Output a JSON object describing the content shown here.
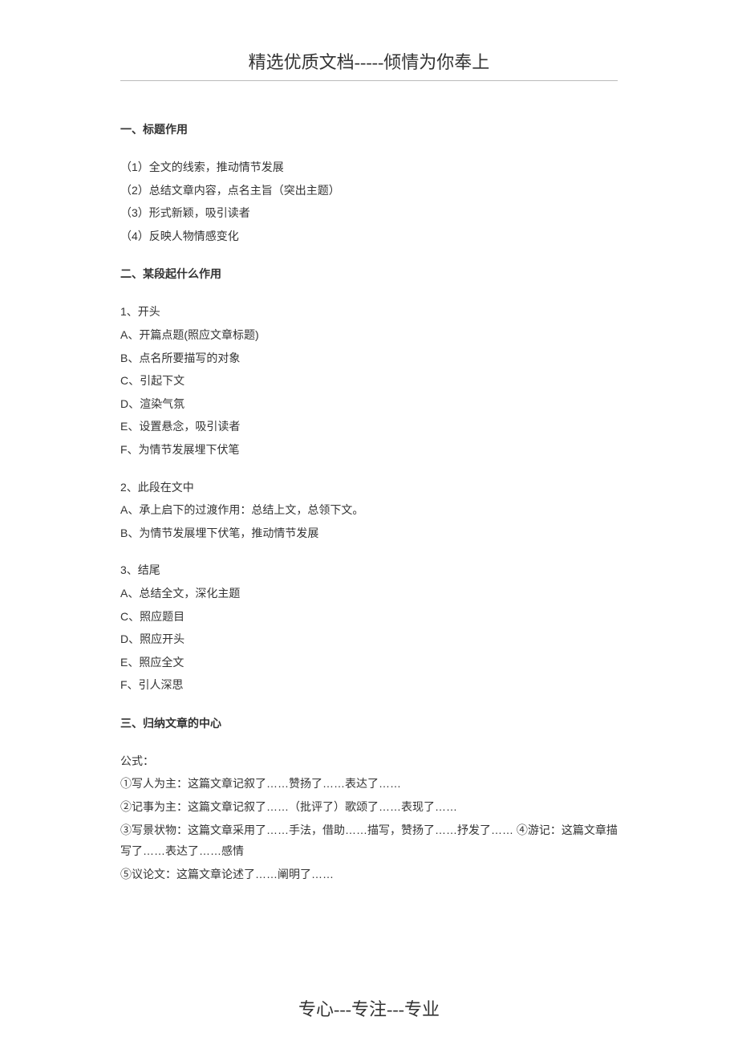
{
  "header": "精选优质文档-----倾情为你奉上",
  "footer": "专心---专注---专业",
  "sections": {
    "s1": {
      "heading": "一、标题作用",
      "items": [
        "（1）全文的线索，推动情节发展",
        "（2）总结文章内容，点名主旨（突出主题）",
        "（3）形式新颖，吸引读者",
        "（4）反映人物情感变化"
      ]
    },
    "s2": {
      "heading": "二、某段起什么作用",
      "sub1": {
        "title": "1、开头",
        "items": [
          "A、开篇点题(照应文章标题)",
          "B、点名所要描写的对象",
          "C、引起下文",
          "D、渲染气氛",
          "E、设置悬念，吸引读者",
          "F、为情节发展埋下伏笔"
        ]
      },
      "sub2": {
        "title": "2、此段在文中",
        "items": [
          "A、承上启下的过渡作用：总结上文，总领下文。",
          "B、为情节发展埋下伏笔，推动情节发展"
        ]
      },
      "sub3": {
        "title": "3、结尾",
        "items": [
          "A、总结全文，深化主题",
          "C、照应题目",
          "D、照应开头",
          "E、照应全文",
          "F、引人深思"
        ]
      }
    },
    "s3": {
      "heading": "三、归纳文章的中心",
      "intro": "公式：",
      "items": [
        "①写人为主：这篇文章记叙了……赞扬了……表达了……",
        "②记事为主：这篇文章记叙了……（批评了）歌颂了……表现了……",
        "③写景状物：这篇文章采用了……手法，借助……描写，赞扬了……抒发了……  ④游记：这篇文章描写了……表达了……感情",
        "⑤议论文：这篇文章论述了……阐明了……"
      ]
    }
  }
}
